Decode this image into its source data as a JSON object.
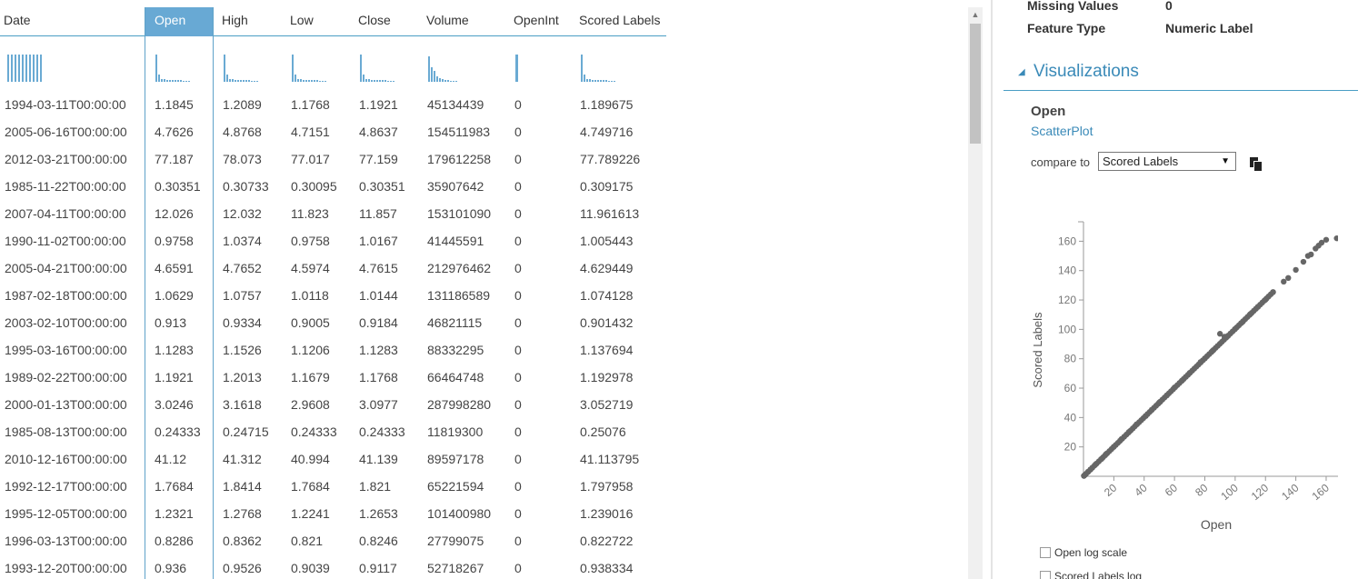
{
  "table": {
    "columns": [
      "Date",
      "Open",
      "High",
      "Low",
      "Close",
      "Volume",
      "OpenInt",
      "Scored Labels"
    ],
    "selected_column": "Open",
    "rows": [
      [
        "1994-03-11T00:00:00",
        "1.1845",
        "1.2089",
        "1.1768",
        "1.1921",
        "45134439",
        "0",
        "1.189675"
      ],
      [
        "2005-06-16T00:00:00",
        "4.7626",
        "4.8768",
        "4.7151",
        "4.8637",
        "154511983",
        "0",
        "4.749716"
      ],
      [
        "2012-03-21T00:00:00",
        "77.187",
        "78.073",
        "77.017",
        "77.159",
        "179612258",
        "0",
        "77.789226"
      ],
      [
        "1985-11-22T00:00:00",
        "0.30351",
        "0.30733",
        "0.30095",
        "0.30351",
        "35907642",
        "0",
        "0.309175"
      ],
      [
        "2007-04-11T00:00:00",
        "12.026",
        "12.032",
        "11.823",
        "11.857",
        "153101090",
        "0",
        "11.961613"
      ],
      [
        "1990-11-02T00:00:00",
        "0.9758",
        "1.0374",
        "0.9758",
        "1.0167",
        "41445591",
        "0",
        "1.005443"
      ],
      [
        "2005-04-21T00:00:00",
        "4.6591",
        "4.7652",
        "4.5974",
        "4.7615",
        "212976462",
        "0",
        "4.629449"
      ],
      [
        "1987-02-18T00:00:00",
        "1.0629",
        "1.0757",
        "1.0118",
        "1.0144",
        "131186589",
        "0",
        "1.074128"
      ],
      [
        "2003-02-10T00:00:00",
        "0.913",
        "0.9334",
        "0.9005",
        "0.9184",
        "46821115",
        "0",
        "0.901432"
      ],
      [
        "1995-03-16T00:00:00",
        "1.1283",
        "1.1526",
        "1.1206",
        "1.1283",
        "88332295",
        "0",
        "1.137694"
      ],
      [
        "1989-02-22T00:00:00",
        "1.1921",
        "1.2013",
        "1.1679",
        "1.1768",
        "66464748",
        "0",
        "1.192978"
      ],
      [
        "2000-01-13T00:00:00",
        "3.0246",
        "3.1618",
        "2.9608",
        "3.0977",
        "287998280",
        "0",
        "3.052719"
      ],
      [
        "1985-08-13T00:00:00",
        "0.24333",
        "0.24715",
        "0.24333",
        "0.24333",
        "11819300",
        "0",
        "0.25076"
      ],
      [
        "2010-12-16T00:00:00",
        "41.12",
        "41.312",
        "40.994",
        "41.139",
        "89597178",
        "0",
        "41.113795"
      ],
      [
        "1992-12-17T00:00:00",
        "1.7684",
        "1.8414",
        "1.7684",
        "1.821",
        "65221594",
        "0",
        "1.797958"
      ],
      [
        "1995-12-05T00:00:00",
        "1.2321",
        "1.2768",
        "1.2241",
        "1.2653",
        "101400980",
        "0",
        "1.239016"
      ],
      [
        "1996-03-13T00:00:00",
        "0.8286",
        "0.8362",
        "0.821",
        "0.8246",
        "27799075",
        "0",
        "0.822722"
      ],
      [
        "1993-12-20T00:00:00",
        "0.936",
        "0.9526",
        "0.9039",
        "0.9117",
        "52718267",
        "0",
        "0.938334"
      ]
    ]
  },
  "properties": {
    "missing_values_label": "Missing Values",
    "missing_values_value": "0",
    "feature_type_label": "Feature Type",
    "feature_type_value": "Numeric Label"
  },
  "visualizations": {
    "title": "Visualizations",
    "column_name": "Open",
    "plot_type": "ScatterPlot",
    "compare_label": "compare to",
    "compare_value": "Scored Labels",
    "log_scale_x_label": "Open log scale",
    "log_scale_y_label": "Scored Labels log"
  },
  "colors": {
    "accent": "#3a8ab8",
    "histogram": "#6aaad3",
    "selected_header": "#68a9d4",
    "scatter_points": "#666666"
  },
  "chart_data": {
    "type": "scatter",
    "xlabel": "Open",
    "ylabel": "Scored Labels",
    "xlim": [
      0,
      175
    ],
    "ylim": [
      0,
      172
    ],
    "x_ticks": [
      20,
      40,
      60,
      80,
      100,
      120,
      140,
      160
    ],
    "y_ticks": [
      20,
      40,
      60,
      80,
      100,
      120,
      140,
      160
    ],
    "grid": false,
    "series": [
      {
        "points": [
          [
            0.3,
            0.31
          ],
          [
            0.9,
            0.9
          ],
          [
            1.2,
            1.19
          ],
          [
            3,
            3.05
          ],
          [
            4.7,
            4.7
          ],
          [
            8,
            8.1
          ],
          [
            12,
            11.96
          ],
          [
            15,
            15.2
          ],
          [
            20,
            20.1
          ],
          [
            25,
            25.3
          ],
          [
            30,
            30.2
          ],
          [
            35,
            35.4
          ],
          [
            41.12,
            41.11
          ],
          [
            45,
            45.2
          ],
          [
            50,
            50.3
          ],
          [
            55,
            55.1
          ],
          [
            60,
            60.4
          ],
          [
            65,
            65.2
          ],
          [
            70,
            70.3
          ],
          [
            77.19,
            77.79
          ],
          [
            80,
            80.2
          ],
          [
            85,
            85.3
          ],
          [
            90,
            97
          ],
          [
            93,
            95
          ],
          [
            95,
            95.4
          ],
          [
            100,
            100.3
          ],
          [
            105,
            105.2
          ],
          [
            110,
            110.4
          ],
          [
            115,
            115.3
          ],
          [
            120,
            120.2
          ],
          [
            125,
            125.4
          ],
          [
            132,
            132.5
          ],
          [
            135,
            135
          ],
          [
            140,
            140.5
          ],
          [
            145,
            146
          ],
          [
            148,
            150
          ],
          [
            150,
            151
          ],
          [
            153,
            155
          ],
          [
            155,
            157
          ],
          [
            157,
            159
          ],
          [
            160,
            161
          ],
          [
            167,
            162
          ],
          [
            178,
            172
          ]
        ]
      }
    ]
  }
}
